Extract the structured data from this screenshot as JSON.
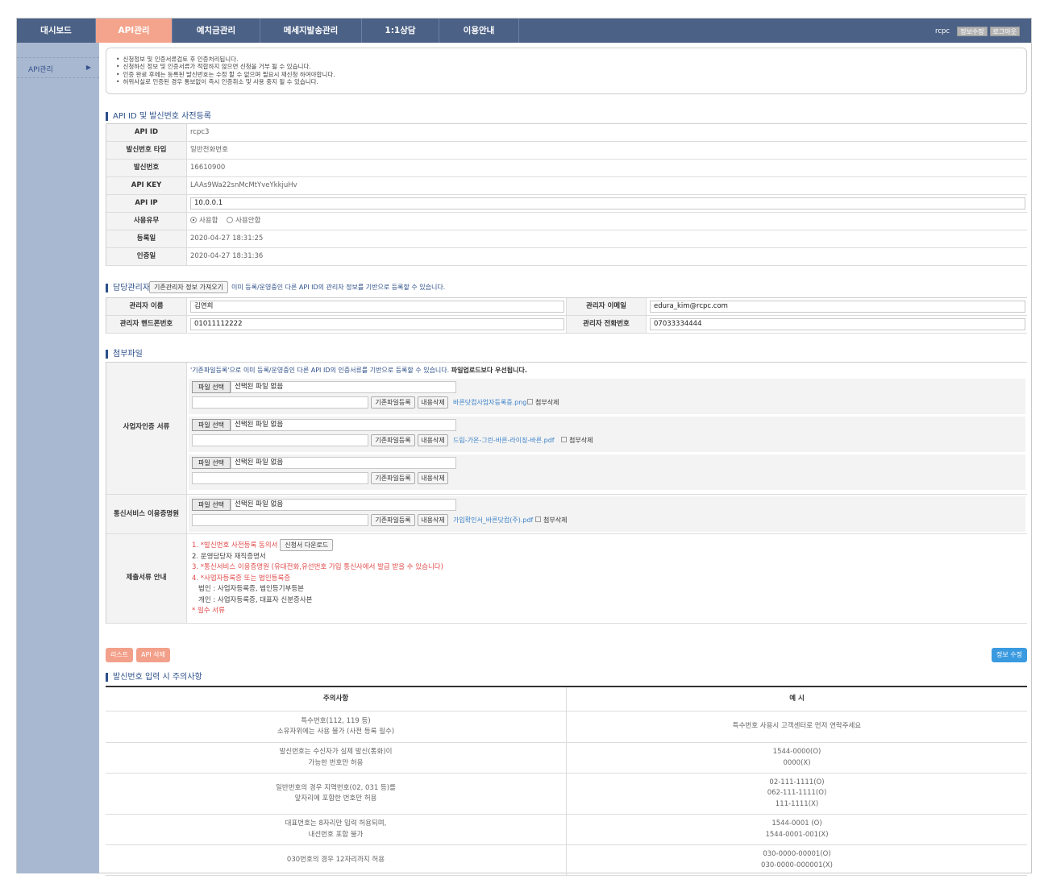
{
  "nav": {
    "items": [
      "대시보드",
      "API관리",
      "예치금관리",
      "메세지발송관리",
      "1:1상담",
      "이용안내"
    ],
    "active": 1,
    "user": "rcpc",
    "edit_btn": "정보수정",
    "logout_btn": "로그아웃"
  },
  "sidebar": {
    "items": [
      {
        "label": "API관리",
        "arrow": "▶"
      }
    ]
  },
  "notice": [
    "신청정보 및 인증서류검토 후 인증처리됩니다.",
    "신청하신 정보 및 인증서류가 적합하지 않으면 신청을 거부 될 수 있습니다.",
    "인증 완료 후에는 등록된 발신번호는 수정 할 수 없으며 필요시 재신청 하여야합니다.",
    "허위사실로 인증된 경우 통보없이 즉시 인증취소 및 사용 중지 될 수 있습니다."
  ],
  "api_section": {
    "title": "API ID 및 발신번호 사전등록",
    "api_id_label": "API ID",
    "api_id": "rcpc3",
    "sender_type_label": "발신번호 타입",
    "sender_type": "일반전화번호",
    "sender_label": "발신번호",
    "sender": "16610900",
    "api_key_label": "API KEY",
    "api_key": "LAAs9Wa22snMcMtYveYkkjuHv",
    "api_ip_label": "API IP",
    "api_ip": "10.0.0.1",
    "use_label": "사용유무",
    "use_on": "사용함",
    "use_off": "사용안함",
    "reg_label": "등록일",
    "reg_date": "2020-04-27 18:31:25",
    "cert_label": "인증일",
    "cert_date": "2020-04-27 18:31:36"
  },
  "manager": {
    "title": "담당관리자",
    "fetch_btn": "기존관리자 정보 가져오기",
    "hint": "이미 등록/운영중인 다른 API ID의 관리자 정보를 기반으로 등록할 수 있습니다.",
    "name_label": "관리자 이름",
    "name": "김연희",
    "email_label": "관리자 이메일",
    "email": "edura_kim@rcpc.com",
    "phone_label": "관리자 핸드폰번호",
    "phone": "01011112222",
    "tel_label": "관리자 전화번호",
    "tel": "07033334444"
  },
  "attach": {
    "title": "첨부파일",
    "biz_label": "사업자인증 서류",
    "hint_a": "'기존파일등록'으로 이미 등록/운영중인 다른 API ID의 인증서류를 기반으로 등록할 수 있습니다. ",
    "hint_b": "파일업로드보다 우선됩니다.",
    "file_btn": "파일 선택",
    "no_file": "선택된 파일 없음",
    "existing_btn": "기존파일등록",
    "delete_btn": "내용삭제",
    "delete_attach": "첨부삭제",
    "file1": "바른닷컴사업자등록증.png",
    "file2": "드림-가온-그린-바른-라이징-바른.pdf",
    "telecom_label": "통신서비스 이용증명원",
    "file3": "가입확인서_바른닷컴(주).pdf",
    "docs_label": "제출서류 안내",
    "doc1": "1. *발신번호 사전등록 동의서",
    "doc1_btn": "신청서 다운로드",
    "doc2": "2. 운영담당자 재직증명서",
    "doc3": "3. *통신서비스 이용증명원 (유대전화,유선번호 가입 통신사에서 발급 받을 수 있습니다)",
    "doc4": "4. *사업자등록증 또는 법인등록증",
    "doc4a": "법인 : 사업자등록증, 법인등기부등본",
    "doc4b": "개인 : 사업자등록증, 대표자 신분증사본",
    "required": "* 필수 서류"
  },
  "actions": {
    "list": "리스트",
    "delete": "API 삭제",
    "edit": "정보 수정"
  },
  "warnings": {
    "title": "발신번호 입력 시 주의사항",
    "col1": "주의사항",
    "col2": "예 시",
    "rows": [
      {
        "left": [
          "특수번호(112, 119 등)",
          "소유자위에는 사용 불가 (사전 등록 필수)"
        ],
        "right": [
          "특수번호 사용시 고객센터로 먼저 연락주세요"
        ]
      },
      {
        "left": [
          "발신번호는 수신자가 실제 발신(통화)이",
          "가능한 번호만 허용"
        ],
        "right": [
          "1544-0000(O)",
          "0000(X)"
        ]
      },
      {
        "left": [
          "일반번호의 경우 지역번호(02, 031 등)를",
          "앞자리에 포함한 번호만 허용"
        ],
        "right": [
          "02-111-1111(O)",
          "062-111-1111(O)",
          "111-1111(X)"
        ]
      },
      {
        "left": [
          "대표번호는 8자리만 입력 허용되며,",
          "내선번호 포함 불가"
        ],
        "right": [
          "1544-0001 (O)",
          "1544-0001-001(X)"
        ]
      },
      {
        "left": [
          "030번호의 경우 12자리까지 허용"
        ],
        "right": [
          "030-0000-00001(O)",
          "030-0000-000001(X)"
        ]
      }
    ]
  },
  "colors": {
    "nav": "#4b6186",
    "active": "#f4a48c",
    "sidebar": "#a8b8d0",
    "primary_btn": "#3a9ae0",
    "danger_btn": "#f3a08a"
  }
}
